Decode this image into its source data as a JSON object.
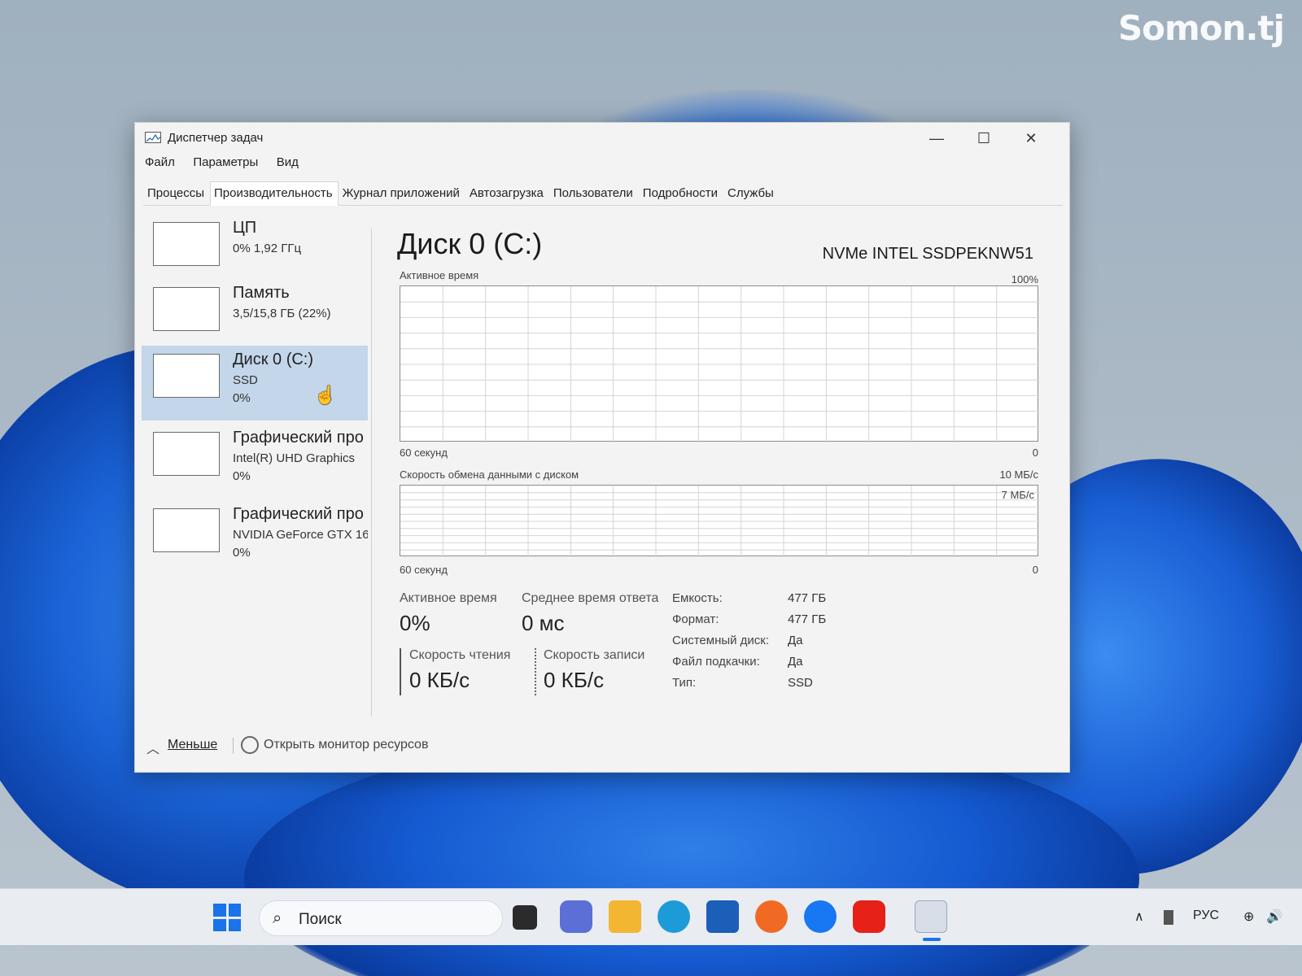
{
  "watermark": "Somon.tj",
  "window": {
    "title": "Диспетчер задач",
    "controls": {
      "minimize": "—",
      "maximize": "☐",
      "close": "✕"
    }
  },
  "menu": [
    "Файл",
    "Параметры",
    "Вид"
  ],
  "tabs": [
    "Процессы",
    "Производительность",
    "Журнал приложений",
    "Автозагрузка",
    "Пользователи",
    "Подробности",
    "Службы"
  ],
  "active_tab": "Производительность",
  "sidebar": [
    {
      "name": "ЦП",
      "sub": "0% 1,92 ГГц",
      "sub2": ""
    },
    {
      "name": "Память",
      "sub": "3,5/15,8 ГБ (22%)",
      "sub2": ""
    },
    {
      "name": "Диск 0 (C:)",
      "sub": "SSD",
      "sub2": "0%"
    },
    {
      "name": "Графический про",
      "sub": "Intel(R) UHD Graphics",
      "sub2": "0%"
    },
    {
      "name": "Графический про",
      "sub": "NVIDIA GeForce GTX 16",
      "sub2": "0%"
    }
  ],
  "main": {
    "title": "Диск 0 (C:)",
    "model": "NVMe INTEL SSDPEKNW51",
    "graph1": {
      "label": "Активное время",
      "max": "100%",
      "time": "60 секунд",
      "min": "0"
    },
    "graph2": {
      "label": "Скорость обмена данными с диском",
      "max": "10 МБ/с",
      "inner": "7 МБ/с",
      "time": "60 секунд",
      "min": "0"
    },
    "stats": {
      "active_label": "Активное время",
      "active_value": "0%",
      "response_label": "Среднее время ответа",
      "response_value": "0 мс",
      "read_label": "Скорость чтения",
      "read_value": "0 КБ/с",
      "write_label": "Скорость записи",
      "write_value": "0 КБ/с"
    },
    "properties": [
      {
        "label": "Емкость:",
        "value": "477 ГБ"
      },
      {
        "label": "Формат:",
        "value": "477 ГБ"
      },
      {
        "label": "Системный диск:",
        "value": "Да"
      },
      {
        "label": "Файл подкачки:",
        "value": "Да"
      },
      {
        "label": "Тип:",
        "value": "SSD"
      }
    ]
  },
  "footer": {
    "less": "Меньше",
    "monitor": "Открыть монитор ресурсов"
  },
  "taskbar": {
    "search_placeholder": "Поиск",
    "language": "РУС",
    "apps": [
      "task-view",
      "meet",
      "file-explorer",
      "edge",
      "store",
      "firefox",
      "facebook",
      "youtube",
      "task-manager"
    ]
  },
  "colors": {
    "accent": "#1a73e8",
    "selected": "#c3d6ea",
    "window_bg": "#f3f3f3"
  }
}
